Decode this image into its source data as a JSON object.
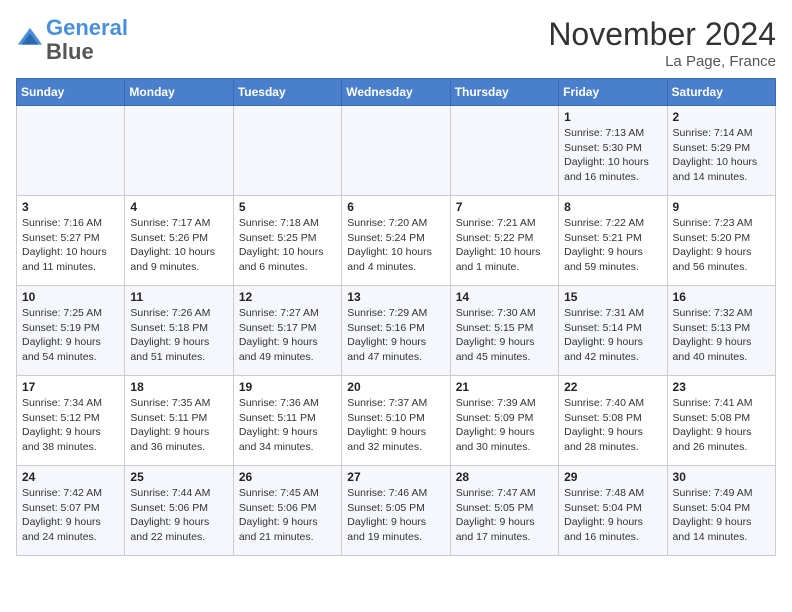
{
  "header": {
    "logo_line1": "General",
    "logo_line2": "Blue",
    "month": "November 2024",
    "location": "La Page, France"
  },
  "weekdays": [
    "Sunday",
    "Monday",
    "Tuesday",
    "Wednesday",
    "Thursday",
    "Friday",
    "Saturday"
  ],
  "weeks": [
    [
      {
        "day": "",
        "info": ""
      },
      {
        "day": "",
        "info": ""
      },
      {
        "day": "",
        "info": ""
      },
      {
        "day": "",
        "info": ""
      },
      {
        "day": "",
        "info": ""
      },
      {
        "day": "1",
        "info": "Sunrise: 7:13 AM\nSunset: 5:30 PM\nDaylight: 10 hours and 16 minutes."
      },
      {
        "day": "2",
        "info": "Sunrise: 7:14 AM\nSunset: 5:29 PM\nDaylight: 10 hours and 14 minutes."
      }
    ],
    [
      {
        "day": "3",
        "info": "Sunrise: 7:16 AM\nSunset: 5:27 PM\nDaylight: 10 hours and 11 minutes."
      },
      {
        "day": "4",
        "info": "Sunrise: 7:17 AM\nSunset: 5:26 PM\nDaylight: 10 hours and 9 minutes."
      },
      {
        "day": "5",
        "info": "Sunrise: 7:18 AM\nSunset: 5:25 PM\nDaylight: 10 hours and 6 minutes."
      },
      {
        "day": "6",
        "info": "Sunrise: 7:20 AM\nSunset: 5:24 PM\nDaylight: 10 hours and 4 minutes."
      },
      {
        "day": "7",
        "info": "Sunrise: 7:21 AM\nSunset: 5:22 PM\nDaylight: 10 hours and 1 minute."
      },
      {
        "day": "8",
        "info": "Sunrise: 7:22 AM\nSunset: 5:21 PM\nDaylight: 9 hours and 59 minutes."
      },
      {
        "day": "9",
        "info": "Sunrise: 7:23 AM\nSunset: 5:20 PM\nDaylight: 9 hours and 56 minutes."
      }
    ],
    [
      {
        "day": "10",
        "info": "Sunrise: 7:25 AM\nSunset: 5:19 PM\nDaylight: 9 hours and 54 minutes."
      },
      {
        "day": "11",
        "info": "Sunrise: 7:26 AM\nSunset: 5:18 PM\nDaylight: 9 hours and 51 minutes."
      },
      {
        "day": "12",
        "info": "Sunrise: 7:27 AM\nSunset: 5:17 PM\nDaylight: 9 hours and 49 minutes."
      },
      {
        "day": "13",
        "info": "Sunrise: 7:29 AM\nSunset: 5:16 PM\nDaylight: 9 hours and 47 minutes."
      },
      {
        "day": "14",
        "info": "Sunrise: 7:30 AM\nSunset: 5:15 PM\nDaylight: 9 hours and 45 minutes."
      },
      {
        "day": "15",
        "info": "Sunrise: 7:31 AM\nSunset: 5:14 PM\nDaylight: 9 hours and 42 minutes."
      },
      {
        "day": "16",
        "info": "Sunrise: 7:32 AM\nSunset: 5:13 PM\nDaylight: 9 hours and 40 minutes."
      }
    ],
    [
      {
        "day": "17",
        "info": "Sunrise: 7:34 AM\nSunset: 5:12 PM\nDaylight: 9 hours and 38 minutes."
      },
      {
        "day": "18",
        "info": "Sunrise: 7:35 AM\nSunset: 5:11 PM\nDaylight: 9 hours and 36 minutes."
      },
      {
        "day": "19",
        "info": "Sunrise: 7:36 AM\nSunset: 5:11 PM\nDaylight: 9 hours and 34 minutes."
      },
      {
        "day": "20",
        "info": "Sunrise: 7:37 AM\nSunset: 5:10 PM\nDaylight: 9 hours and 32 minutes."
      },
      {
        "day": "21",
        "info": "Sunrise: 7:39 AM\nSunset: 5:09 PM\nDaylight: 9 hours and 30 minutes."
      },
      {
        "day": "22",
        "info": "Sunrise: 7:40 AM\nSunset: 5:08 PM\nDaylight: 9 hours and 28 minutes."
      },
      {
        "day": "23",
        "info": "Sunrise: 7:41 AM\nSunset: 5:08 PM\nDaylight: 9 hours and 26 minutes."
      }
    ],
    [
      {
        "day": "24",
        "info": "Sunrise: 7:42 AM\nSunset: 5:07 PM\nDaylight: 9 hours and 24 minutes."
      },
      {
        "day": "25",
        "info": "Sunrise: 7:44 AM\nSunset: 5:06 PM\nDaylight: 9 hours and 22 minutes."
      },
      {
        "day": "26",
        "info": "Sunrise: 7:45 AM\nSunset: 5:06 PM\nDaylight: 9 hours and 21 minutes."
      },
      {
        "day": "27",
        "info": "Sunrise: 7:46 AM\nSunset: 5:05 PM\nDaylight: 9 hours and 19 minutes."
      },
      {
        "day": "28",
        "info": "Sunrise: 7:47 AM\nSunset: 5:05 PM\nDaylight: 9 hours and 17 minutes."
      },
      {
        "day": "29",
        "info": "Sunrise: 7:48 AM\nSunset: 5:04 PM\nDaylight: 9 hours and 16 minutes."
      },
      {
        "day": "30",
        "info": "Sunrise: 7:49 AM\nSunset: 5:04 PM\nDaylight: 9 hours and 14 minutes."
      }
    ]
  ]
}
